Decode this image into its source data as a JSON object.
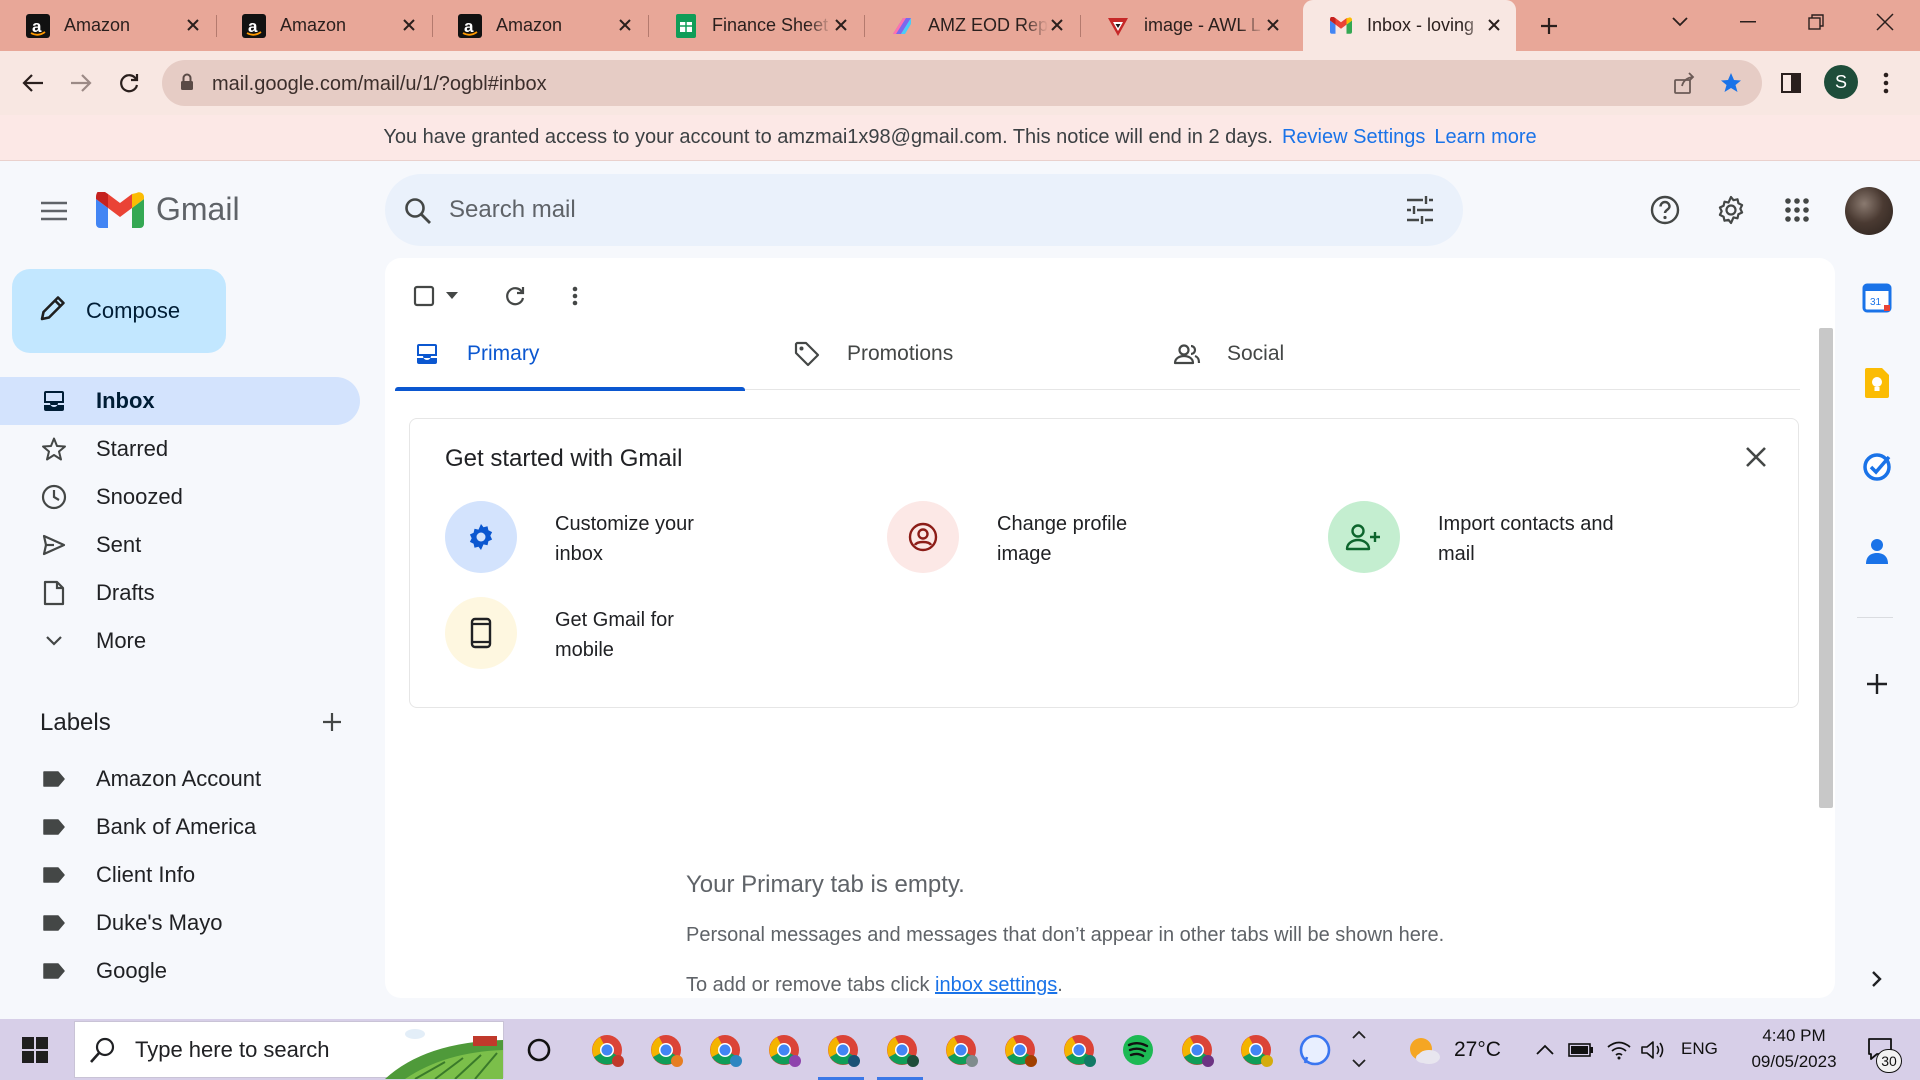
{
  "browser": {
    "tabs": [
      {
        "label": "Amazon",
        "icon": "amazon-icon"
      },
      {
        "label": "Amazon",
        "icon": "amazon-icon"
      },
      {
        "label": "Amazon",
        "icon": "amazon-icon"
      },
      {
        "label": "Finance Sheet",
        "icon": "sheets-icon"
      },
      {
        "label": "AMZ EOD Rep",
        "icon": "clickup-icon"
      },
      {
        "label": "image - AWL L",
        "icon": "awl-icon"
      },
      {
        "label": "Inbox - loving",
        "icon": "gmail-icon",
        "active": true
      }
    ],
    "url": "mail.google.com/mail/u/1/?ogbl#inbox",
    "profile_initial": "S"
  },
  "notice": {
    "text": "You have granted access to your account to amzmai1x98@gmail.com. This notice will end in 2 days.",
    "review_link": "Review Settings",
    "learn_link": "Learn more"
  },
  "gmail": {
    "logo_text": "Gmail",
    "search_placeholder": "Search mail",
    "compose_label": "Compose",
    "nav": [
      {
        "label": "Inbox",
        "icon": "inbox-icon",
        "active": true
      },
      {
        "label": "Starred",
        "icon": "star-icon"
      },
      {
        "label": "Snoozed",
        "icon": "clock-icon"
      },
      {
        "label": "Sent",
        "icon": "send-icon"
      },
      {
        "label": "Drafts",
        "icon": "draft-icon"
      },
      {
        "label": "More",
        "icon": "chevron-down-icon"
      }
    ],
    "labels_title": "Labels",
    "labels": [
      "Amazon Account",
      "Bank of America",
      "Client Info",
      "Duke's Mayo",
      "Google"
    ],
    "tabs": [
      {
        "label": "Primary",
        "icon": "inbox-icon",
        "active": true
      },
      {
        "label": "Promotions",
        "icon": "tag-icon"
      },
      {
        "label": "Social",
        "icon": "people-icon"
      }
    ],
    "get_started": {
      "title": "Get started with Gmail",
      "items": [
        {
          "label": "Customize your inbox",
          "icon": "gear-icon",
          "color": "#d3e3fd"
        },
        {
          "label": "Change profile image",
          "icon": "account-circle-icon",
          "color": "#fce8e6"
        },
        {
          "label": "Import contacts and mail",
          "icon": "person-add-icon",
          "color": "#c4eed0"
        },
        {
          "label": "Get Gmail for mobile",
          "icon": "phone-icon",
          "color": "#fef7e0"
        }
      ]
    },
    "empty": {
      "title": "Your Primary tab is empty.",
      "subtitle": "Personal messages and messages that don’t appear in other tabs will be shown here.",
      "settings_prefix": "To add or remove tabs click",
      "settings_link": "inbox settings",
      "settings_suffix": "."
    }
  },
  "taskbar": {
    "search_placeholder": "Type here to search",
    "weather": "27°C",
    "language": "ENG",
    "time": "4:40 PM",
    "date": "09/05/2023",
    "notifications": "30"
  },
  "colors": {
    "tabstrip": "#e8a798",
    "toolbar": "#f8e7e2",
    "accent": "#0b57d0",
    "compose": "#c2e7ff",
    "active_nav": "#d3e3fd"
  }
}
